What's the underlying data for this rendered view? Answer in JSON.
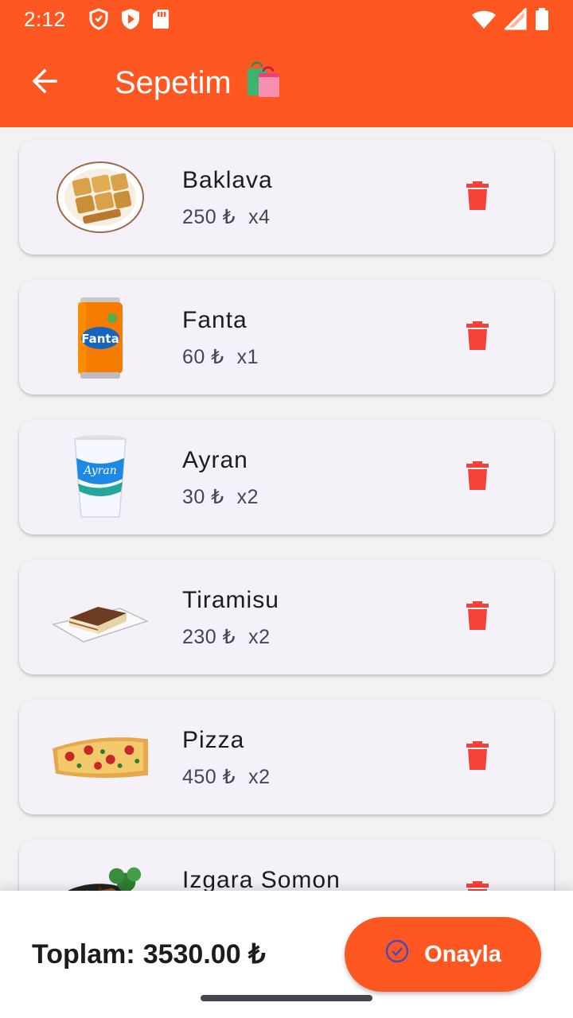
{
  "status": {
    "time": "2:12"
  },
  "appbar": {
    "title": "Sepetim",
    "title_emoji": "🛍️"
  },
  "cart": {
    "items": [
      {
        "name": "Baklava",
        "price": "250 ₺",
        "qty": "x4",
        "icon": "baklava-image"
      },
      {
        "name": "Fanta",
        "price": "60 ₺",
        "qty": "x1",
        "icon": "fanta-can-image"
      },
      {
        "name": "Ayran",
        "price": "30 ₺",
        "qty": "x2",
        "icon": "ayran-cup-image"
      },
      {
        "name": "Tiramisu",
        "price": "230 ₺",
        "qty": "x2",
        "icon": "tiramisu-image"
      },
      {
        "name": "Pizza",
        "price": "450 ₺",
        "qty": "x2",
        "icon": "pizza-image"
      },
      {
        "name": "Izgara Somon",
        "price": "",
        "qty": "",
        "icon": "grilled-salmon-image"
      }
    ]
  },
  "footer": {
    "total_label": "Toplam:",
    "total_value": "3530.00 ₺",
    "confirm_label": "Onayla"
  },
  "colors": {
    "primary": "#ff5722",
    "delete": "#f44336",
    "card": "#f5f1f9"
  }
}
